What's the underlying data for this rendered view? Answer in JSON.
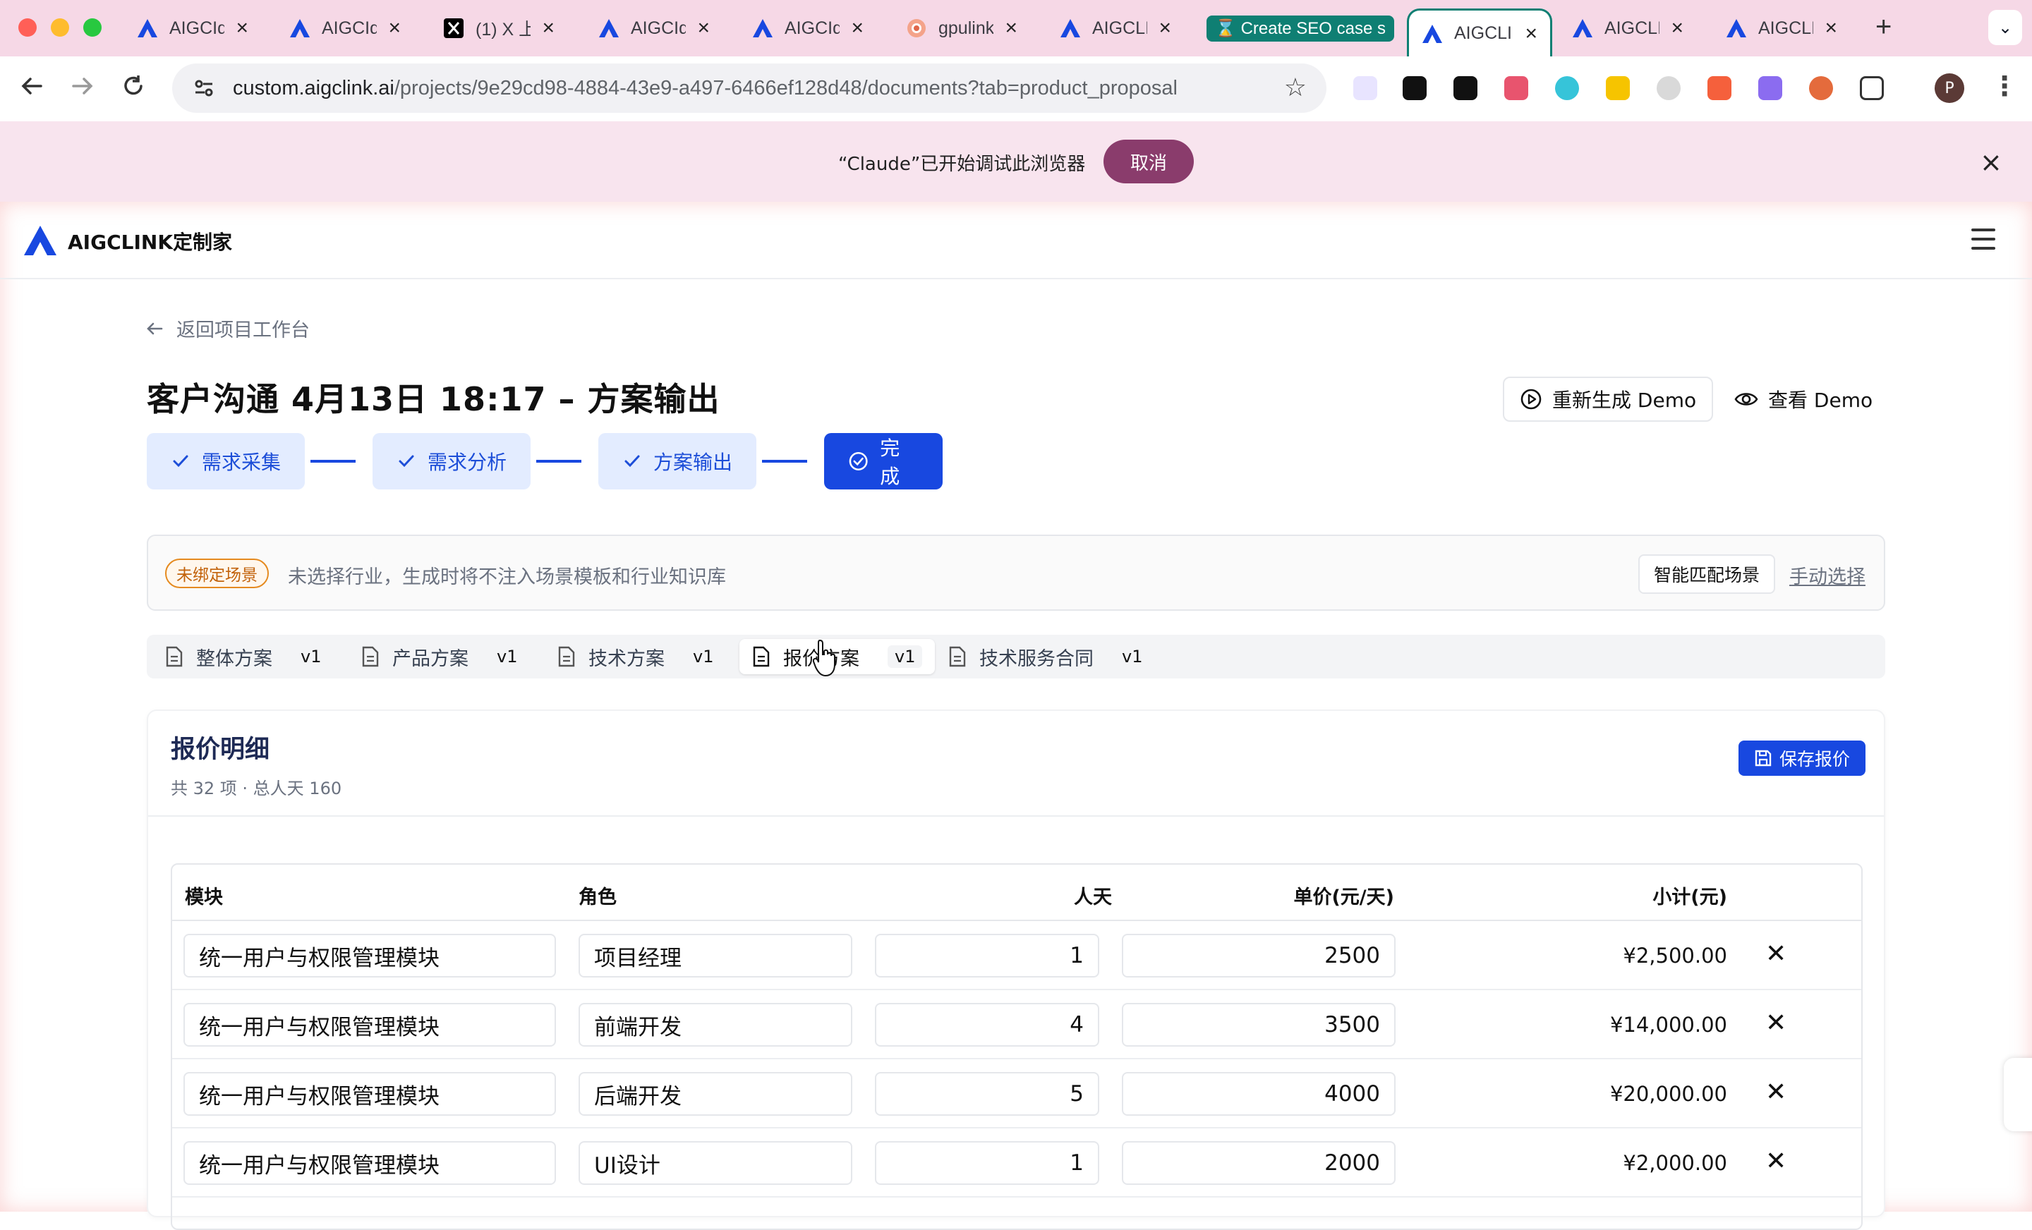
{
  "browser": {
    "tabs": [
      {
        "title": "AIGCId",
        "icon": "aigclink-logo-icon"
      },
      {
        "title": "AIGCId",
        "icon": "aigclink-logo-icon"
      },
      {
        "title": "(1) X 上",
        "icon": "x-logo-icon"
      },
      {
        "title": "AIGCId",
        "icon": "aigclink-logo-icon"
      },
      {
        "title": "AIGCId",
        "icon": "aigclink-logo-icon"
      },
      {
        "title": "gpulink",
        "icon": "gpulink-icon"
      },
      {
        "title": "AIGCLI",
        "icon": "aigclink-logo-icon"
      },
      {
        "title": "Create SEO case s",
        "icon": "hourglass-icon"
      },
      {
        "title": "AIGCLI",
        "icon": "aigclink-logo-icon"
      },
      {
        "title": "AIGCLI",
        "icon": "aigclink-logo-icon"
      },
      {
        "title": "AIGCLI",
        "icon": "aigclink-logo-icon"
      }
    ],
    "new_tab": "+",
    "url_host": "custom.aigclink.ai",
    "url_path": "/projects/9e29cd98-4884-43e9-a497-6466ef128d48/documents?tab=product_proposal",
    "profile_initial": "P"
  },
  "infobar": {
    "message": "“Claude”已开始调试此浏览器",
    "cancel_label": "取消"
  },
  "app": {
    "brand": "AIGCLINK定制家",
    "accent": "#1848e0",
    "back_label": "返回项目工作台",
    "title": "客户沟通 4月13日 18:17 – 方案输出",
    "regen_label": "重新生成 Demo",
    "view_label": "查看 Demo",
    "steps": [
      {
        "label": "需求采集"
      },
      {
        "label": "需求分析"
      },
      {
        "label": "方案输出"
      },
      {
        "label": "完成"
      }
    ],
    "scene": {
      "badge": "未绑定场景",
      "hint": "未选择行业，生成时将不注入场景模板和行业知识库",
      "smart_label": "智能匹配场景",
      "manual_label": "手动选择"
    },
    "doc_tabs": [
      {
        "label": "整体方案",
        "version": "v1"
      },
      {
        "label": "产品方案",
        "version": "v1"
      },
      {
        "label": "技术方案",
        "version": "v1"
      },
      {
        "label": "报价方案",
        "version": "v1"
      },
      {
        "label": "技术服务合同",
        "version": "v1"
      }
    ],
    "quote": {
      "title": "报价明细",
      "summary": "共 32 项 · 总人天 160",
      "save_label": "保存报价",
      "columns": [
        "模块",
        "角色",
        "人天",
        "单价(元/天)",
        "小计(元)"
      ],
      "rows": [
        {
          "module": "统一用户与权限管理模块",
          "role": "项目经理",
          "days": "1",
          "price": "2500",
          "subtotal": "¥2,500.00"
        },
        {
          "module": "统一用户与权限管理模块",
          "role": "前端开发",
          "days": "4",
          "price": "3500",
          "subtotal": "¥14,000.00"
        },
        {
          "module": "统一用户与权限管理模块",
          "role": "后端开发",
          "days": "5",
          "price": "4000",
          "subtotal": "¥20,000.00"
        },
        {
          "module": "统一用户与权限管理模块",
          "role": "UI设计",
          "days": "1",
          "price": "2000",
          "subtotal": "¥2,000.00"
        }
      ]
    }
  }
}
